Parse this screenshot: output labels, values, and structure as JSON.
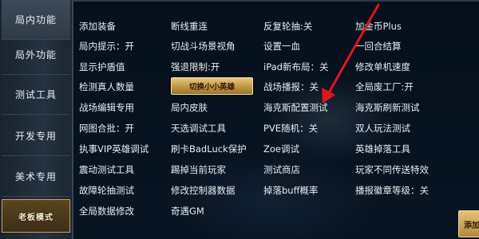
{
  "sidebar": {
    "tabs": [
      {
        "label": "局内功能"
      },
      {
        "label": "局外功能"
      },
      {
        "label": "测试工具"
      },
      {
        "label": "开发专用"
      },
      {
        "label": "美术专用"
      },
      {
        "label": "老板模式"
      }
    ]
  },
  "grid": {
    "col1": [
      "添加装备",
      "局内提示：开",
      "显示护盾值",
      "检测真人数量",
      "战场编辑专用",
      "网图合批：开",
      "执事VIP英雄调试",
      "震动测试工具",
      "故障轮抽测试",
      "全局数据修改"
    ],
    "col2": [
      "断线重连",
      "切战斗场景视角",
      "强退限制:开",
      "局内皮肤",
      "天选调试工具",
      "刷卡BadLuck保护",
      "踢掉当前玩家",
      "修改控制器数据",
      "奇遇GM"
    ],
    "col3": [
      "反复轮抽:关",
      "设置一血",
      "iPad新布局：关",
      "战场播报：关",
      "海克斯配置测试",
      "PVE随机：关",
      "Zoe调试",
      "测试商店",
      "掉落buff概率"
    ],
    "col4": [
      "加金币Plus",
      "一回合结算",
      "修改单机速度",
      "全局废工厂:开",
      "海克斯刷新测试",
      "双人玩法测试",
      "英雄掉落工具",
      "玩家不同传送特效",
      "播报徽章等级：关"
    ]
  },
  "switch_button": {
    "label": "切换小小英雄"
  },
  "add_button": {
    "label": "添加"
  },
  "colors": {
    "accent": "#c8a45a",
    "arrow": "#e3131b",
    "text": "#e6ecf1"
  }
}
